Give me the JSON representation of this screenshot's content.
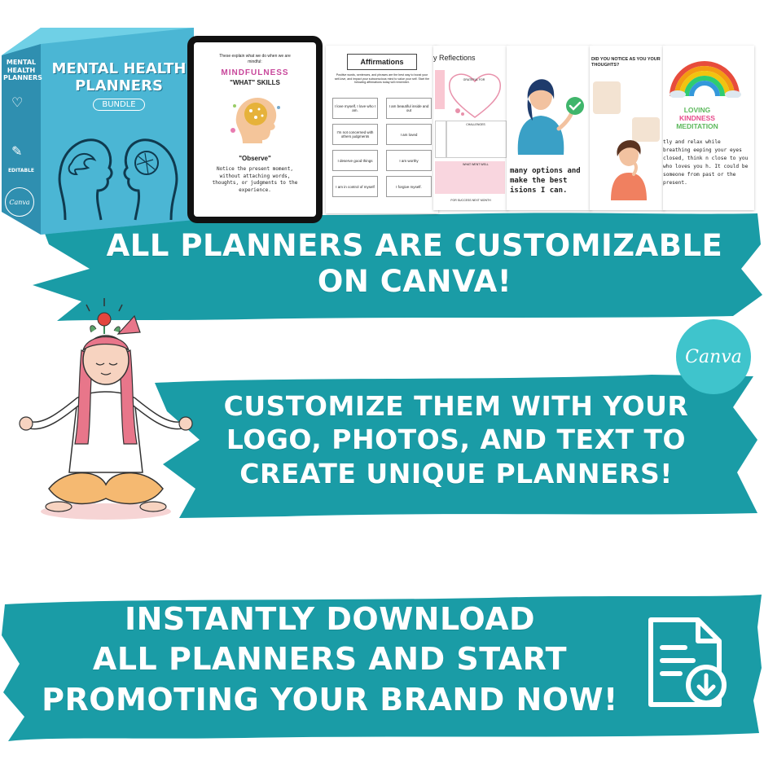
{
  "product_box": {
    "title_line1": "MENTAL HEALTH",
    "title_line2": "PLANNERS",
    "badge": "BUNDLE",
    "side_title_line1": "MENTAL",
    "side_title_line2": "HEALTH",
    "side_title_line3": "PLANNERS",
    "side_label": "EDITABLE",
    "side_logo": "Canva"
  },
  "preview_pages": {
    "tablet": {
      "intro": "These explain what we do when we are mindful:",
      "heading": "MINDFULNESS",
      "subheading": "\"WHAT\" SKILLS",
      "skill": "\"Observe\"",
      "body": "Notice the present moment, without attaching words, thoughts, or judgments to the experience."
    },
    "affirmations": {
      "title": "Affirmations",
      "intro": "Positive words, sentences, and phrases are the best way to boost your self-love, and impact your subconscious mind to value your self. Start the following affirmations today will remember.",
      "cells": [
        "I love myself, I love who I am.",
        "I am beautiful inside and out",
        "I'm not concerned with others judgments",
        "I am loved",
        "I deserve good things",
        "I am worthy",
        "I am in control of myself",
        "I forgive myself."
      ]
    },
    "reflections": {
      "title": "y Reflections",
      "grateful": "GRATEFUL FOR",
      "challenges": "CHALLENGES",
      "went_well": "WHAT WENT WELL",
      "success": "FOR SUCCESS NEXT MONTH"
    },
    "decisions": {
      "text": "many options and make the best isions I can."
    },
    "notice": {
      "text": "DID YOU NOTICE AS YOU YOUR THOUGHTS?"
    },
    "kindness": {
      "title_line1": "LOVING",
      "title_line2": "KINDNESS",
      "title_line3": "MEDITATION",
      "body": "tly and relax while breathing eeping your eyes closed, think n close to you who loves you h. It could be someone from past or the present."
    }
  },
  "banners": {
    "first_line1": "ALL PLANNERS ARE CUSTOMIZABLE",
    "first_line2": "ON CANVA!",
    "second_line1": "CUSTOMIZE THEM WITH YOUR",
    "second_line2": "LOGO, PHOTOS, AND TEXT TO",
    "second_line3": "CREATE UNIQUE PLANNERS!",
    "third_line1": "INSTANTLY DOWNLOAD",
    "third_line2": "ALL PLANNERS AND START",
    "third_line3": "PROMOTING YOUR BRAND NOW!"
  },
  "canva_badge": "Canva",
  "icons": {
    "download": "download-file-icon",
    "meditation": "meditating-woman-illustration",
    "check": "check-icon"
  },
  "colors": {
    "teal": "#1a9ca6",
    "teal_dark": "#15848d",
    "box_blue": "#4bb6d4",
    "canva_badge": "#3fc4cc",
    "white": "#ffffff"
  }
}
